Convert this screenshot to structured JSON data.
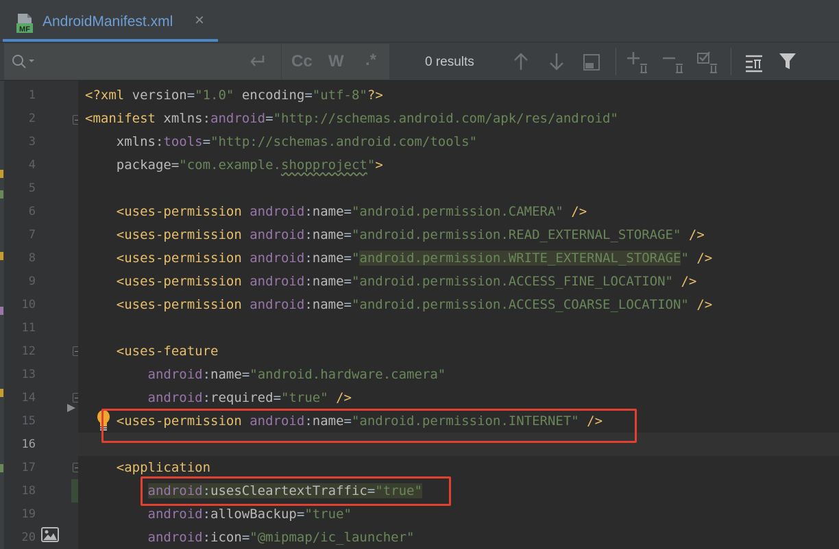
{
  "tab": {
    "icon": "android-manifest-file-icon",
    "icon_text": "MF",
    "title": "AndroidManifest.xml",
    "close": "×"
  },
  "find": {
    "search_icon": "search-icon",
    "results": "0 results",
    "toggles": [
      {
        "name": "match-case-toggle",
        "label": "Cc"
      },
      {
        "name": "whole-words-toggle",
        "label": "W"
      },
      {
        "name": "regex-toggle",
        "label": ".*"
      }
    ],
    "actions": [
      "previous-occurrence-icon",
      "next-occurrence-icon",
      "select-all-occurrences-icon",
      "add-selection-icon",
      "remove-selection-icon",
      "exclude-selection-icon",
      "show-filter-popup-icon",
      "filter-icon"
    ]
  },
  "editor": {
    "current_line": 16,
    "lines": [
      {
        "n": "1",
        "tokens": [
          [
            "tag",
            "<?xml "
          ],
          [
            "attr",
            "version"
          ],
          [
            "plain",
            "="
          ],
          [
            "val",
            "\"1.0\""
          ],
          [
            "plain",
            " "
          ],
          [
            "attr",
            "encoding"
          ],
          [
            "plain",
            "="
          ],
          [
            "val",
            "\"utf-8\""
          ],
          [
            "tag",
            "?>"
          ]
        ]
      },
      {
        "n": "2",
        "tokens": [
          [
            "tag",
            "<manifest "
          ],
          [
            "attr",
            "xmlns"
          ],
          [
            "plain",
            ":"
          ],
          [
            "ns",
            "android"
          ],
          [
            "plain",
            "="
          ],
          [
            "val",
            "\"http://schemas.android.com/apk/res/android\""
          ]
        ]
      },
      {
        "n": "3",
        "tokens": [
          [
            "plain",
            "    "
          ],
          [
            "attr",
            "xmlns"
          ],
          [
            "plain",
            ":"
          ],
          [
            "ns",
            "tools"
          ],
          [
            "plain",
            "="
          ],
          [
            "val",
            "\"http://schemas.android.com/tools\""
          ]
        ]
      },
      {
        "n": "4",
        "tokens": [
          [
            "plain",
            "    "
          ],
          [
            "attr",
            "package"
          ],
          [
            "plain",
            "="
          ],
          [
            "val",
            "\"com.example."
          ],
          [
            "wavy",
            "shopproject"
          ],
          [
            "val",
            "\""
          ],
          [
            "tag",
            ">"
          ]
        ]
      },
      {
        "n": "5",
        "tokens": []
      },
      {
        "n": "6",
        "tokens": [
          [
            "plain",
            "    "
          ],
          [
            "tag",
            "<uses-permission "
          ],
          [
            "ns",
            "android"
          ],
          [
            "plain",
            ":"
          ],
          [
            "attr",
            "name"
          ],
          [
            "plain",
            "="
          ],
          [
            "val",
            "\"android.permission.CAMERA\""
          ],
          [
            "plain",
            " "
          ],
          [
            "tag",
            "/>"
          ]
        ]
      },
      {
        "n": "7",
        "tokens": [
          [
            "plain",
            "    "
          ],
          [
            "tag",
            "<uses-permission "
          ],
          [
            "ns",
            "android"
          ],
          [
            "plain",
            ":"
          ],
          [
            "attr",
            "name"
          ],
          [
            "plain",
            "="
          ],
          [
            "val",
            "\"android.permission.READ_EXTERNAL_STORAGE\""
          ],
          [
            "plain",
            " "
          ],
          [
            "tag",
            "/>"
          ]
        ]
      },
      {
        "n": "8",
        "tokens": [
          [
            "plain",
            "    "
          ],
          [
            "tag",
            "<uses-permission "
          ],
          [
            "ns",
            "android"
          ],
          [
            "plain",
            ":"
          ],
          [
            "attr",
            "name"
          ],
          [
            "plain",
            "="
          ],
          [
            "val",
            "\""
          ],
          [
            "hl",
            "android.permission.WRITE_EXTERNAL_STORAGE"
          ],
          [
            "val",
            "\""
          ],
          [
            "plain",
            " "
          ],
          [
            "tag",
            "/>"
          ]
        ]
      },
      {
        "n": "9",
        "tokens": [
          [
            "plain",
            "    "
          ],
          [
            "tag",
            "<uses-permission "
          ],
          [
            "ns",
            "android"
          ],
          [
            "plain",
            ":"
          ],
          [
            "attr",
            "name"
          ],
          [
            "plain",
            "="
          ],
          [
            "val",
            "\"android.permission.ACCESS_FINE_LOCATION\""
          ],
          [
            "plain",
            " "
          ],
          [
            "tag",
            "/>"
          ]
        ]
      },
      {
        "n": "10",
        "tokens": [
          [
            "plain",
            "    "
          ],
          [
            "tag",
            "<uses-permission "
          ],
          [
            "ns",
            "android"
          ],
          [
            "plain",
            ":"
          ],
          [
            "attr",
            "name"
          ],
          [
            "plain",
            "="
          ],
          [
            "val",
            "\"android.permission.ACCESS_COARSE_LOCATION\""
          ],
          [
            "plain",
            " "
          ],
          [
            "tag",
            "/>"
          ]
        ]
      },
      {
        "n": "11",
        "tokens": []
      },
      {
        "n": "12",
        "tokens": [
          [
            "plain",
            "    "
          ],
          [
            "tag",
            "<uses-feature"
          ]
        ]
      },
      {
        "n": "13",
        "tokens": [
          [
            "plain",
            "        "
          ],
          [
            "ns",
            "android"
          ],
          [
            "plain",
            ":"
          ],
          [
            "attr",
            "name"
          ],
          [
            "plain",
            "="
          ],
          [
            "val",
            "\"android.hardware.camera\""
          ]
        ]
      },
      {
        "n": "14",
        "tokens": [
          [
            "plain",
            "        "
          ],
          [
            "ns",
            "android"
          ],
          [
            "plain",
            ":"
          ],
          [
            "attr",
            "required"
          ],
          [
            "plain",
            "="
          ],
          [
            "val",
            "\"true\""
          ],
          [
            "plain",
            " "
          ],
          [
            "tag",
            "/>"
          ]
        ]
      },
      {
        "n": "15",
        "tokens": [
          [
            "plain",
            "    "
          ],
          [
            "tag",
            "<uses-permission "
          ],
          [
            "ns",
            "android"
          ],
          [
            "plain",
            ":"
          ],
          [
            "attr",
            "name"
          ],
          [
            "plain",
            "="
          ],
          [
            "val",
            "\"android.permission.INTERNET\""
          ],
          [
            "plain",
            " "
          ],
          [
            "tag",
            "/>"
          ]
        ]
      },
      {
        "n": "16",
        "tokens": []
      },
      {
        "n": "17",
        "tokens": [
          [
            "plain",
            "    "
          ],
          [
            "tag",
            "<application"
          ]
        ]
      },
      {
        "n": "18",
        "tokens": [
          [
            "plain",
            "        "
          ],
          [
            "nshl",
            "android"
          ],
          [
            "hlp",
            ":"
          ],
          [
            "hla",
            "usesCleartextTraffic"
          ],
          [
            "hlp",
            "="
          ],
          [
            "hl",
            "\"true\""
          ]
        ]
      },
      {
        "n": "19",
        "tokens": [
          [
            "plain",
            "        "
          ],
          [
            "ns",
            "android"
          ],
          [
            "plain",
            ":"
          ],
          [
            "attr",
            "allowBackup"
          ],
          [
            "plain",
            "="
          ],
          [
            "val",
            "\"true\""
          ]
        ]
      },
      {
        "n": "20",
        "tokens": [
          [
            "plain",
            "        "
          ],
          [
            "ns",
            "android"
          ],
          [
            "plain",
            ":"
          ],
          [
            "attr",
            "icon"
          ],
          [
            "plain",
            "="
          ],
          [
            "val",
            "\"@mipmap/ic_launcher\""
          ]
        ]
      }
    ]
  },
  "colors": {
    "background": "#2b2b2b",
    "tag": "#e8bf6a",
    "namespace": "#9876aa",
    "value": "#6a8759",
    "annotation_box": "#e2412f"
  }
}
